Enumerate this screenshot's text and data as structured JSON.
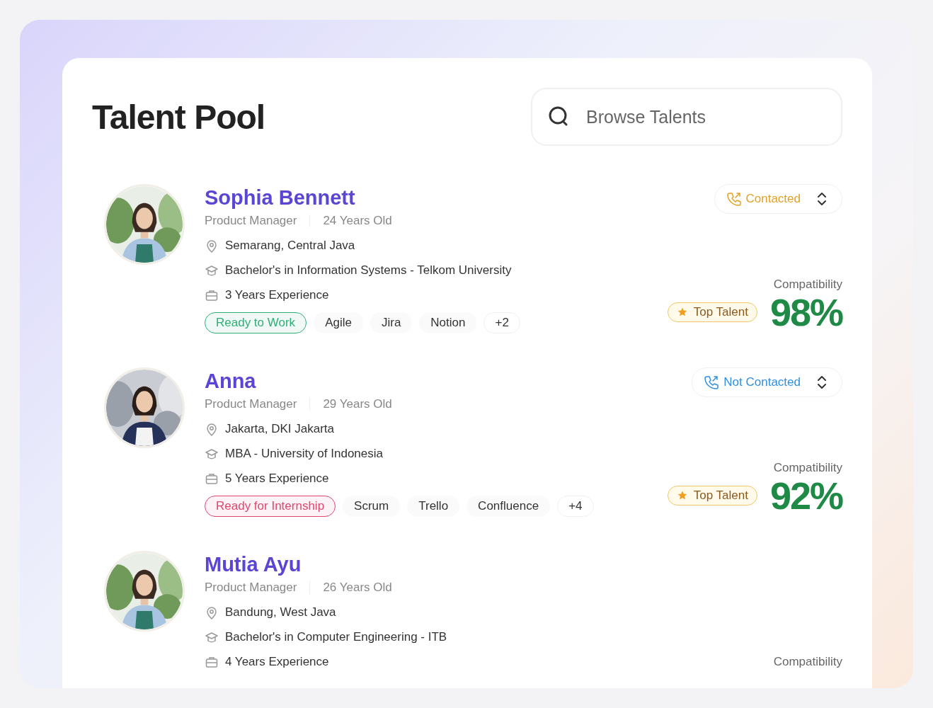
{
  "title": "Talent Pool",
  "search": {
    "placeholder": "Browse Talents"
  },
  "talents": [
    {
      "name": "Sophia Bennett",
      "role": "Product Manager",
      "age": "24 Years Old",
      "location": "Semarang, Central Java",
      "education": "Bachelor's in Information Systems - Telkom University",
      "experience": "3 Years Experience",
      "tags": [
        {
          "kind": "status",
          "label": "Ready to Work",
          "color": "#2fae78"
        },
        {
          "kind": "skill",
          "label": "Agile"
        },
        {
          "kind": "skill",
          "label": "Jira"
        },
        {
          "kind": "skill",
          "label": "Notion"
        },
        {
          "kind": "more",
          "label": "+2"
        }
      ],
      "contact": {
        "label": "Contacted",
        "color": "#e3a124"
      },
      "badge": "Top Talent",
      "compatibility_label": "Compatibility",
      "score": {
        "value": "98%",
        "color": "#1f8a45"
      }
    },
    {
      "name": "Anna",
      "role": "Product Manager",
      "age": "29 Years Old",
      "location": "Jakarta, DKI Jakarta",
      "education": "MBA - University of Indonesia",
      "experience": "5 Years Experience",
      "tags": [
        {
          "kind": "status",
          "label": "Ready for Internship",
          "color": "#e0466e"
        },
        {
          "kind": "skill",
          "label": "Scrum"
        },
        {
          "kind": "skill",
          "label": "Trello"
        },
        {
          "kind": "skill",
          "label": "Confluence"
        },
        {
          "kind": "more",
          "label": "+4"
        }
      ],
      "contact": {
        "label": "Not Contacted",
        "color": "#2f8fe0"
      },
      "badge": "Top Talent",
      "compatibility_label": "Compatibility",
      "score": {
        "value": "92%",
        "color": "#1f8a45"
      }
    },
    {
      "name": "Mutia Ayu",
      "role": "Product Manager",
      "age": "26 Years Old",
      "location": "Bandung, West Java",
      "education": "Bachelor's in Computer Engineering - ITB",
      "experience": "4 Years Experience",
      "compatibility_label": "Compatibility"
    }
  ]
}
